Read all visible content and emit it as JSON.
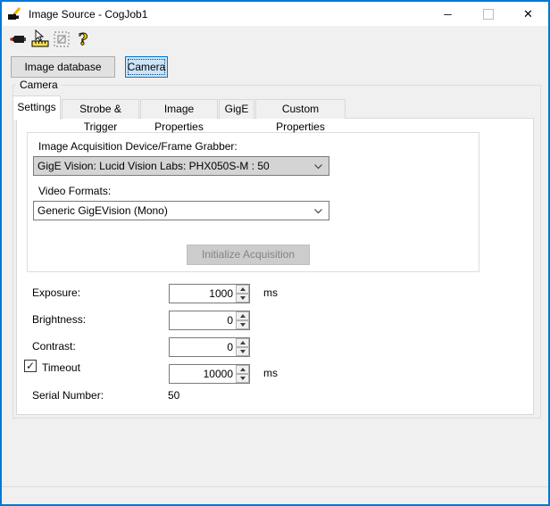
{
  "window": {
    "title": "Image Source - CogJob1"
  },
  "icons": {
    "app": "camera-pencil-icon",
    "minimize": "─",
    "maximize": "window-maximize-square (disabled)",
    "close": "✕",
    "toolbar": [
      "live-camera-icon",
      "setup-cursor-ruler-icon",
      "image-region-icon (disabled)",
      "help-question-icon"
    ],
    "check": "✓",
    "spin_up": "▲",
    "spin_down": "▼",
    "combo_chevron": "⌄"
  },
  "colors": {
    "accent": "#0078d7",
    "titlebar_bg": "#ffffff",
    "dialog_bg": "#f0f0f0",
    "tabpage_bg": "#ffffff",
    "selected_button_bg": "#cce4f7",
    "combo_gray_bg": "#d4d4d4",
    "disabled_text": "#838383",
    "help_icon_yellow": "#ffd400"
  },
  "mode_buttons": {
    "image_database": "Image database",
    "camera": "Camera"
  },
  "camera_group": {
    "label": "Camera"
  },
  "tabs": [
    {
      "label": "Settings",
      "active": true
    },
    {
      "label": "Strobe & Trigger",
      "active": false
    },
    {
      "label": "Image Properties",
      "active": false
    },
    {
      "label": "GigE",
      "active": false
    },
    {
      "label": "Custom Properties",
      "active": false
    }
  ],
  "settings": {
    "device_label": "Image Acquisition Device/Frame Grabber:",
    "device_value": "GigE Vision: Lucid Vision Labs: PHX050S-M : 50",
    "video_formats_label": "Video Formats:",
    "video_formats_value": "Generic GigEVision (Mono)",
    "initialize_button": "Initialize Acquisition",
    "fields": {
      "exposure": {
        "label": "Exposure:",
        "value": "1000",
        "unit": "ms"
      },
      "brightness": {
        "label": "Brightness:",
        "value": "0"
      },
      "contrast": {
        "label": "Contrast:",
        "value": "0"
      },
      "timeout": {
        "label": "Timeout",
        "value": "10000",
        "unit": "ms",
        "checked": true
      },
      "serial_number": {
        "label": "Serial Number:",
        "value": "50"
      }
    }
  }
}
